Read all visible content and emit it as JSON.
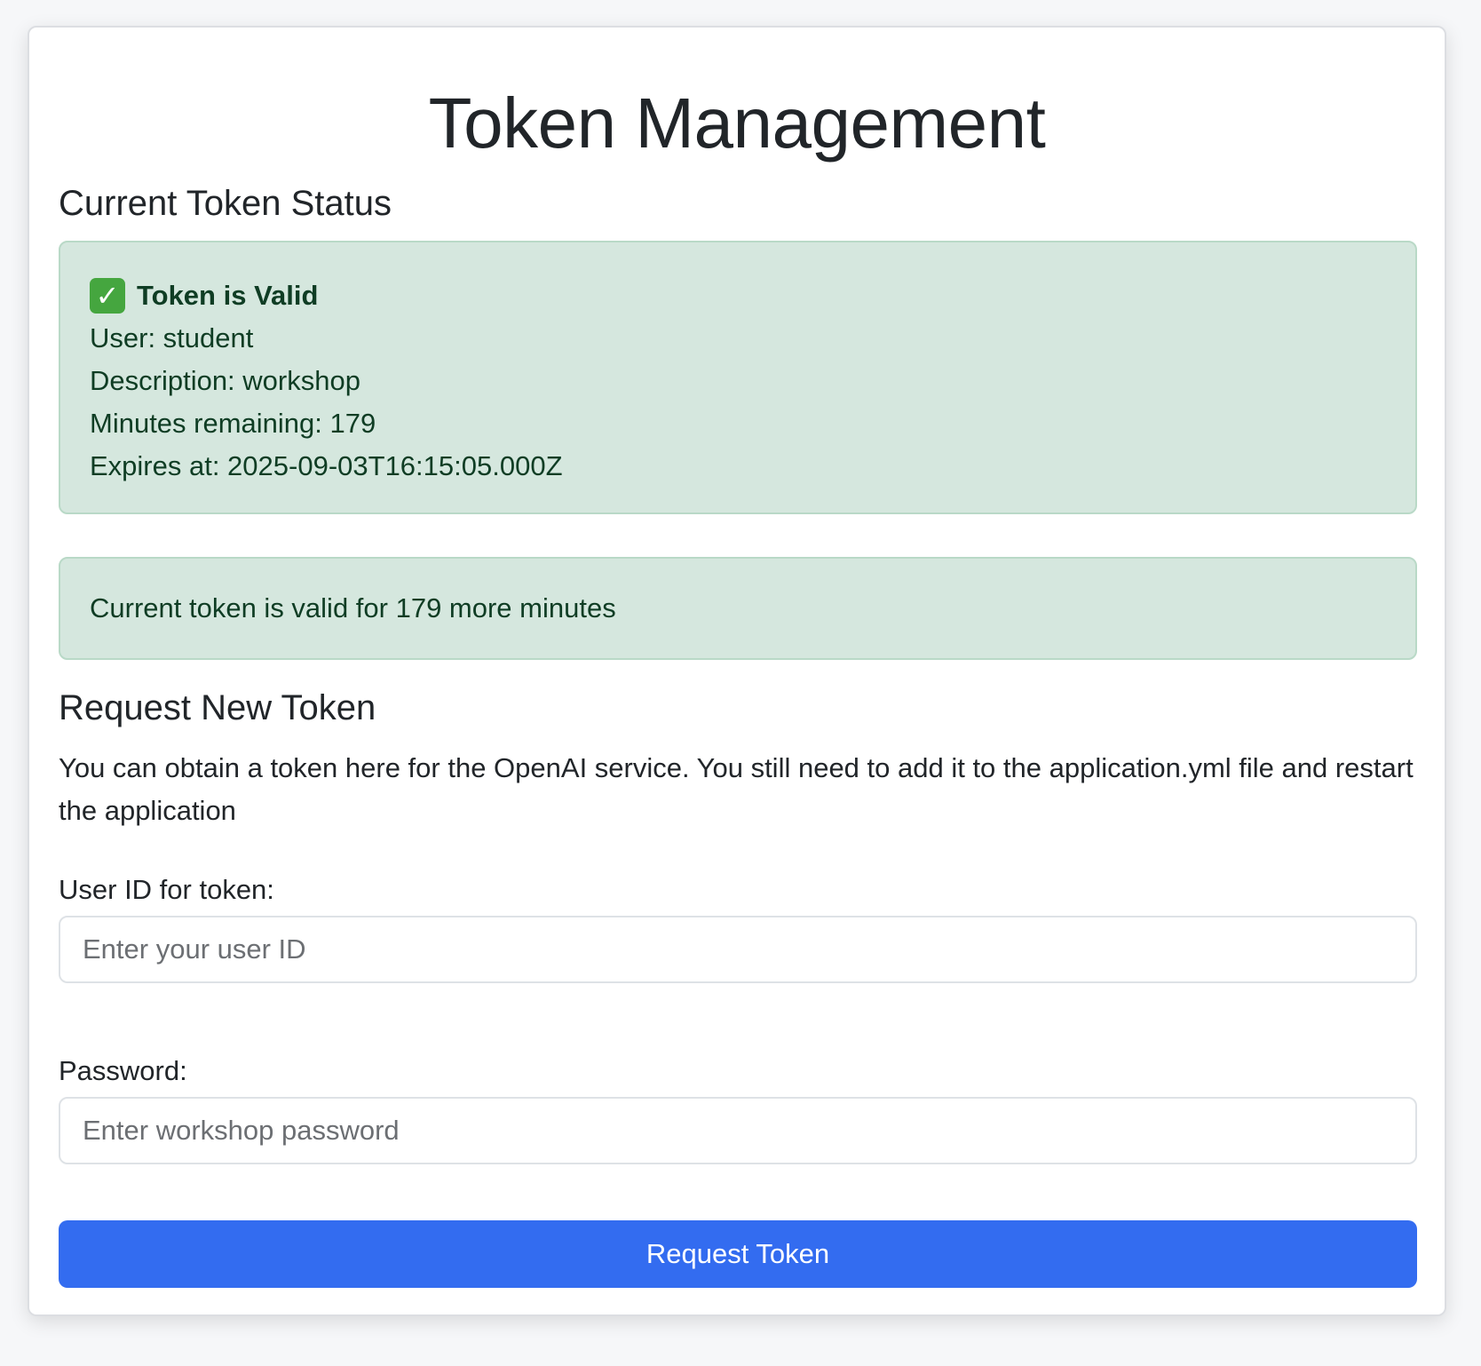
{
  "page": {
    "title": "Token Management"
  },
  "status": {
    "heading": "Current Token Status",
    "valid_label": "Token is Valid",
    "check_icon": "✓",
    "user_line": "User: student",
    "description_line": "Description: workshop",
    "minutes_line": "Minutes remaining: 179",
    "expires_line": "Expires at: 2025-09-03T16:15:05.000Z",
    "remaining_message": "Current token is valid for 179 more minutes"
  },
  "request": {
    "heading": "Request New Token",
    "description": "You can obtain a token here for the OpenAI service. You still need to add it to the application.yml file and restart the application",
    "user_label": "User ID for token:",
    "user_placeholder": "Enter your user ID",
    "user_value": "",
    "password_label": "Password:",
    "password_placeholder": "Enter workshop password",
    "password_value": "",
    "button_label": "Request Token"
  },
  "icons": {
    "valid_status": "check-mark-icon"
  },
  "colors": {
    "success_background": "#d5e7de",
    "success_text": "#0f3d24",
    "primary_button": "#336cf0",
    "check_icon": "#45a63f"
  }
}
